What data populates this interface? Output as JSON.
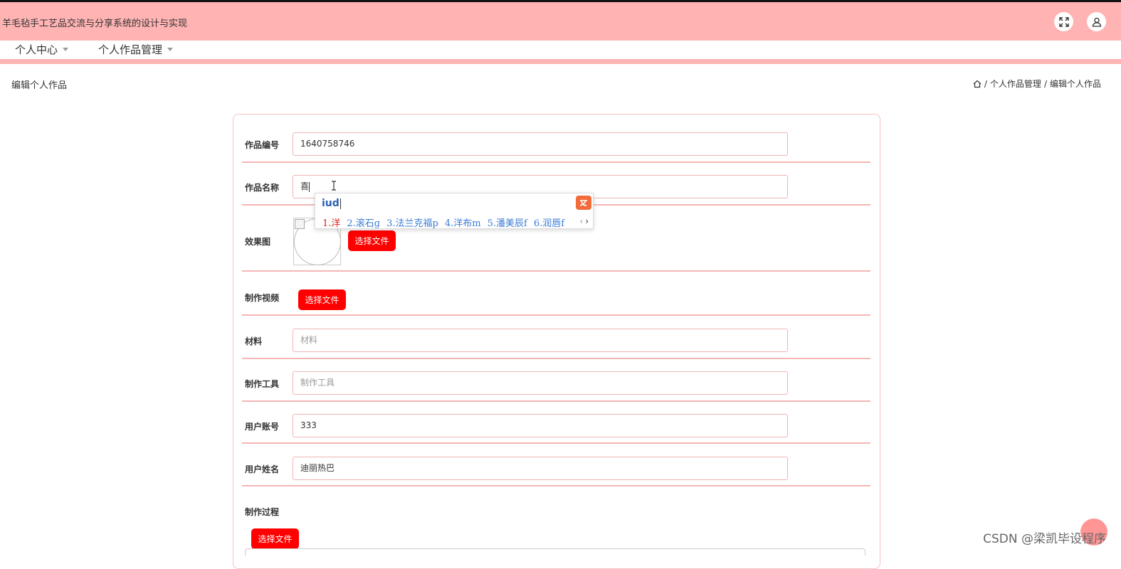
{
  "header": {
    "app_title": "羊毛毡手工艺品交流与分享系统的设计与实现",
    "fullscreen_icon": "expand-icon",
    "user_icon": "user-icon"
  },
  "nav": {
    "items": [
      {
        "label": "个人中心"
      },
      {
        "label": "个人作品管理"
      }
    ]
  },
  "page": {
    "title": "编辑个人作品",
    "breadcrumb": {
      "home_icon": "home-icon",
      "sep1": "/",
      "level1": "个人作品管理",
      "sep2": "/",
      "level2": "编辑个人作品"
    }
  },
  "form": {
    "work_no": {
      "label": "作品编号",
      "value": "1640758746"
    },
    "work_name": {
      "label": "作品名称",
      "value": "喜"
    },
    "effect_image": {
      "label": "效果图",
      "button": "选择文件"
    },
    "video": {
      "label": "制作视频",
      "button": "选择文件"
    },
    "material": {
      "label": "材料",
      "placeholder": "材料"
    },
    "tools": {
      "label": "制作工具",
      "placeholder": "制作工具"
    },
    "account": {
      "label": "用户账号",
      "value": "333"
    },
    "username": {
      "label": "用户姓名",
      "value": "迪丽热巴"
    },
    "process": {
      "label": "制作过程",
      "button": "选择文件"
    }
  },
  "ime": {
    "composition": "iud",
    "candidates": [
      "1.洋",
      "2.滚石g",
      "3.法兰克福p",
      "4.洋布m",
      "5.潘美辰f",
      "6.润唇f"
    ],
    "prev": "‹",
    "next": "›"
  },
  "watermark": "CSDN @梁凯毕设程序",
  "colors": {
    "header_bg": "#ffb3b3",
    "accent": "#ff0000",
    "border": "#f0b4b4"
  }
}
